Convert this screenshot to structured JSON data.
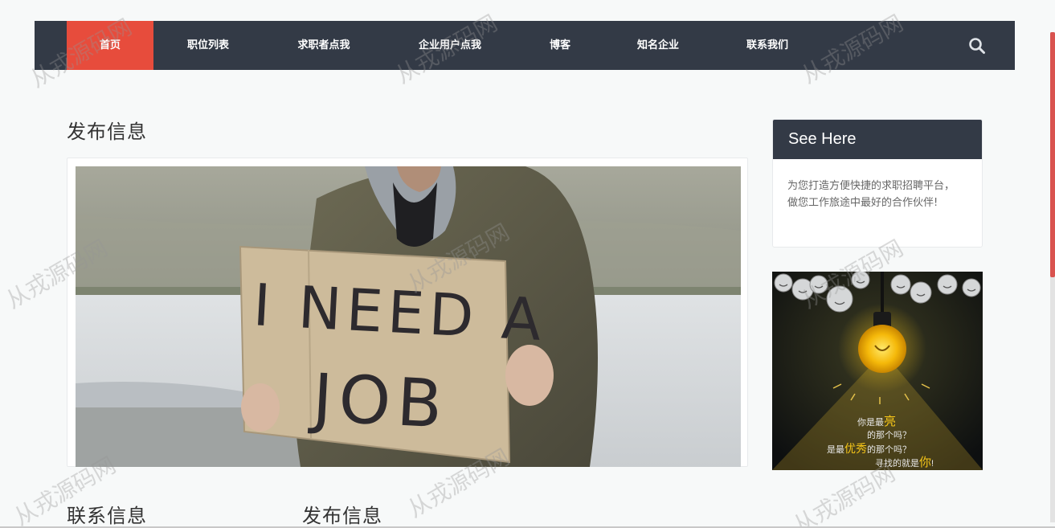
{
  "nav": {
    "items": [
      {
        "label": "首页",
        "active": true
      },
      {
        "label": "职位列表"
      },
      {
        "label": "求职者点我"
      },
      {
        "label": "企业用户点我"
      },
      {
        "label": "博客"
      },
      {
        "label": "知名企业"
      },
      {
        "label": "联系我们"
      }
    ],
    "search_icon": "search-icon"
  },
  "main": {
    "title": "发布信息",
    "hero_sign": {
      "line1": "I NEED A",
      "line2": "JOB"
    }
  },
  "sidebar": {
    "card_title": "See Here",
    "card_text": "为您打造方便快捷的求职招聘平台，做您工作旅途中最好的合作伙伴!",
    "ad": {
      "line1_a": "你是最",
      "line1_b": "亮",
      "line2": "的那个吗？",
      "line3_a": "是最",
      "line3_b": "优秀",
      "line3_c": "的那个吗？",
      "line4_a": "寻找的就是",
      "line4_b": "你",
      "line4_c": "!"
    }
  },
  "footer_sections": {
    "contact_title": "联系信息",
    "publish_title": "发布信息"
  },
  "watermark": "从戎源码网",
  "colors": {
    "nav_bg": "#333a46",
    "nav_active": "#e74c3c",
    "page_bg": "#f7f9f9",
    "bulb_yellow": "#f5c518"
  }
}
